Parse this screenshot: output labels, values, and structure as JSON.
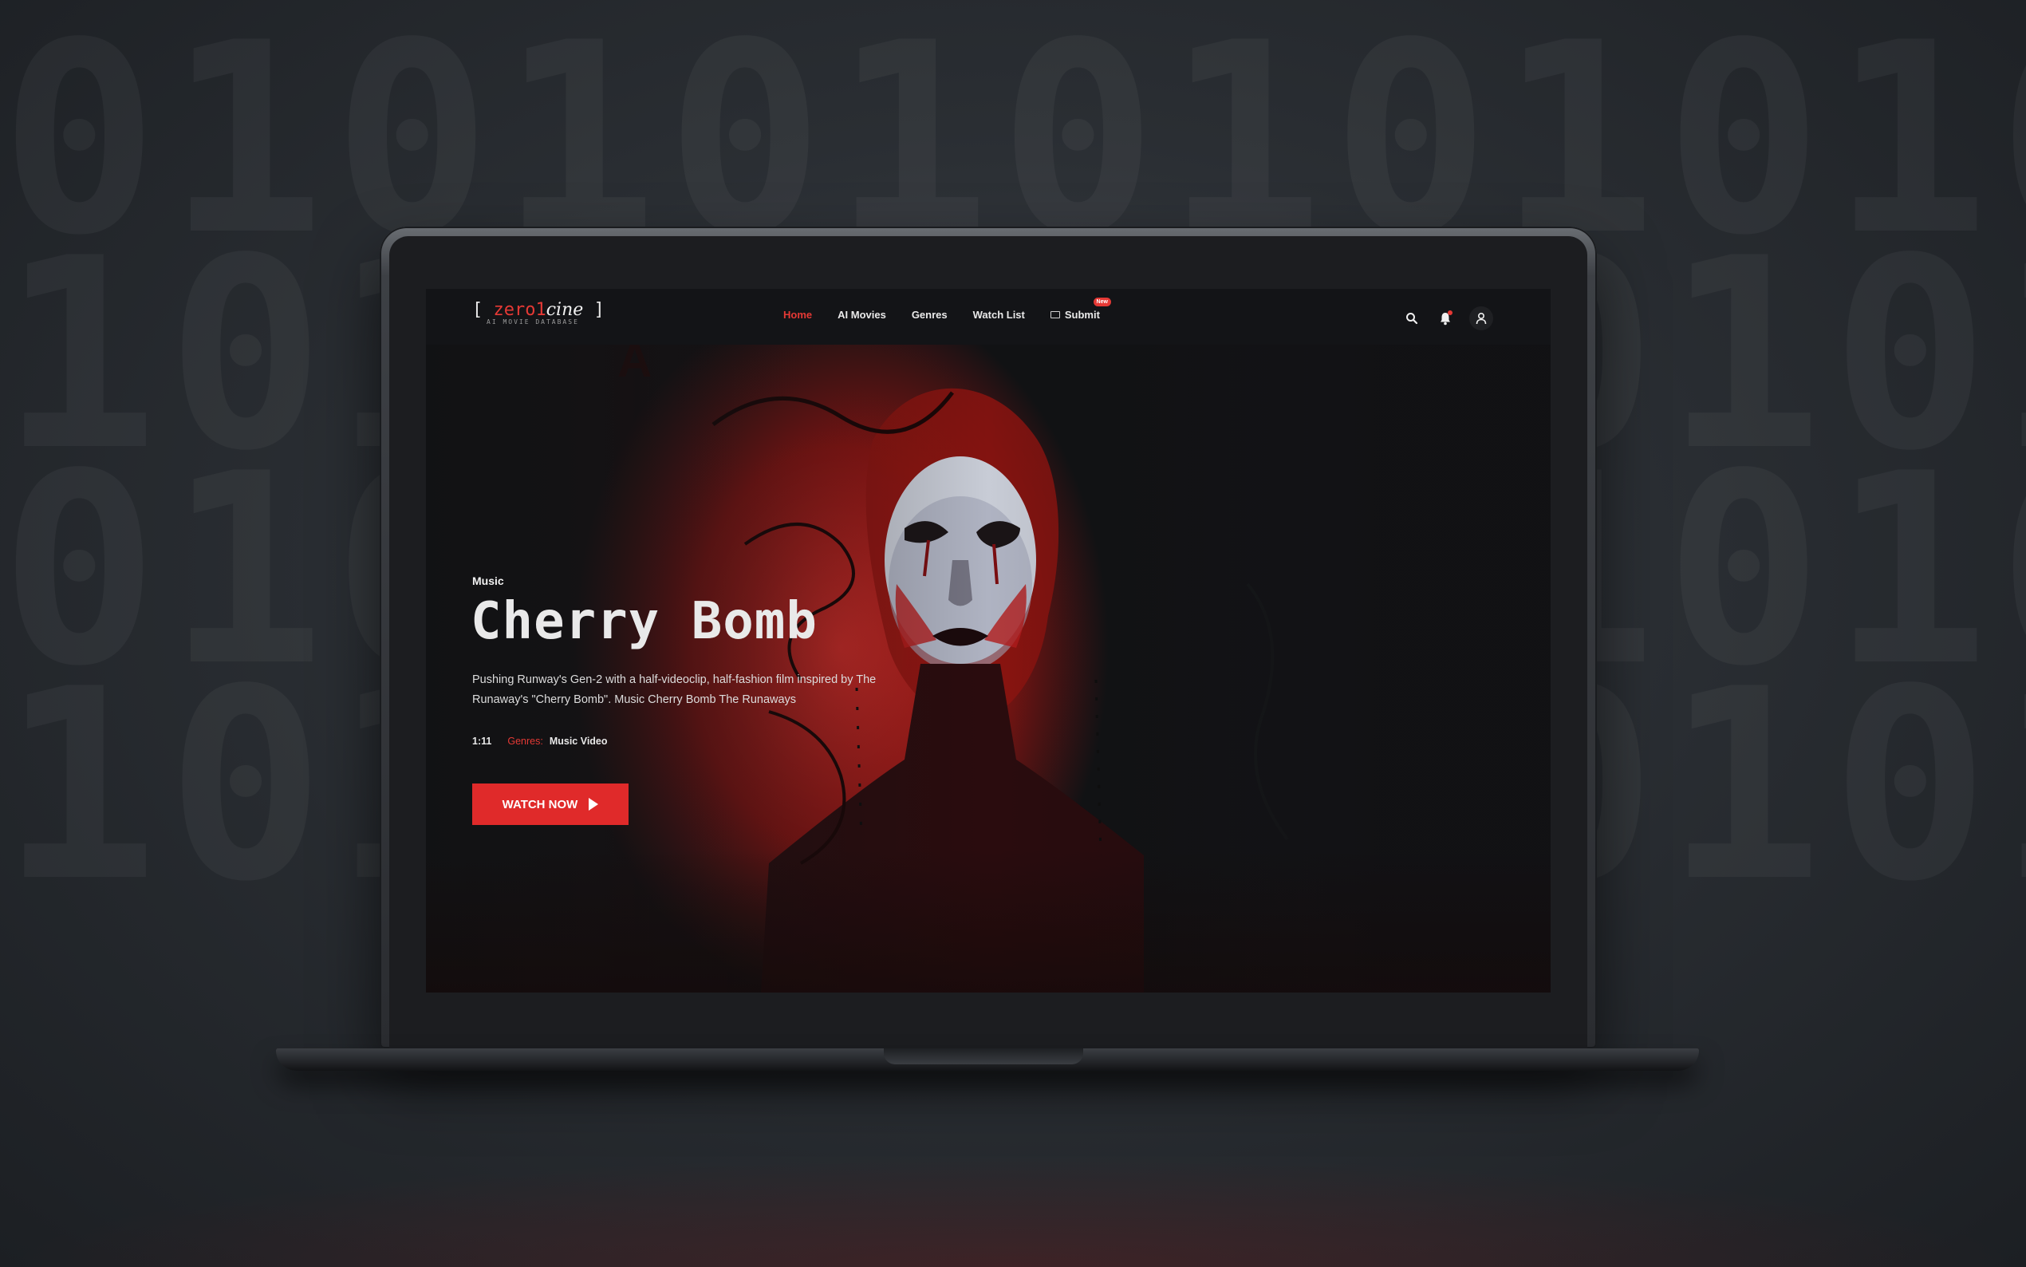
{
  "background": {
    "digits_text": "0101010101010\n1010101010101\n0101010101010\n1010101010101"
  },
  "nav": {
    "logo_bracket_left": "[",
    "logo_zero": "zero1",
    "logo_cine": "cine",
    "logo_bracket_right": "]",
    "logo_subtitle": "AI MOVIE DATABASE",
    "items": [
      {
        "label": "Home",
        "active": true
      },
      {
        "label": "AI Movies"
      },
      {
        "label": "Genres"
      },
      {
        "label": "Watch List"
      },
      {
        "label": "Submit",
        "badge": "New"
      }
    ],
    "icons": [
      "search-icon",
      "bell-icon",
      "user-icon"
    ]
  },
  "hero": {
    "category": "Music",
    "title": "Cherry Bomb",
    "description": "Pushing Runway's Gen-2 with a half-videoclip, half-fashion film inspired by The Runaway's \"Cherry Bomb\". Music Cherry Bomb The Runaways",
    "duration": "1:11",
    "genres_label": "Genres:",
    "genres_value": "Music Video",
    "watch_label": "WATCH NOW"
  },
  "colors": {
    "accent": "#e53935",
    "background": "#111214",
    "hero_red": "#c62a26"
  }
}
